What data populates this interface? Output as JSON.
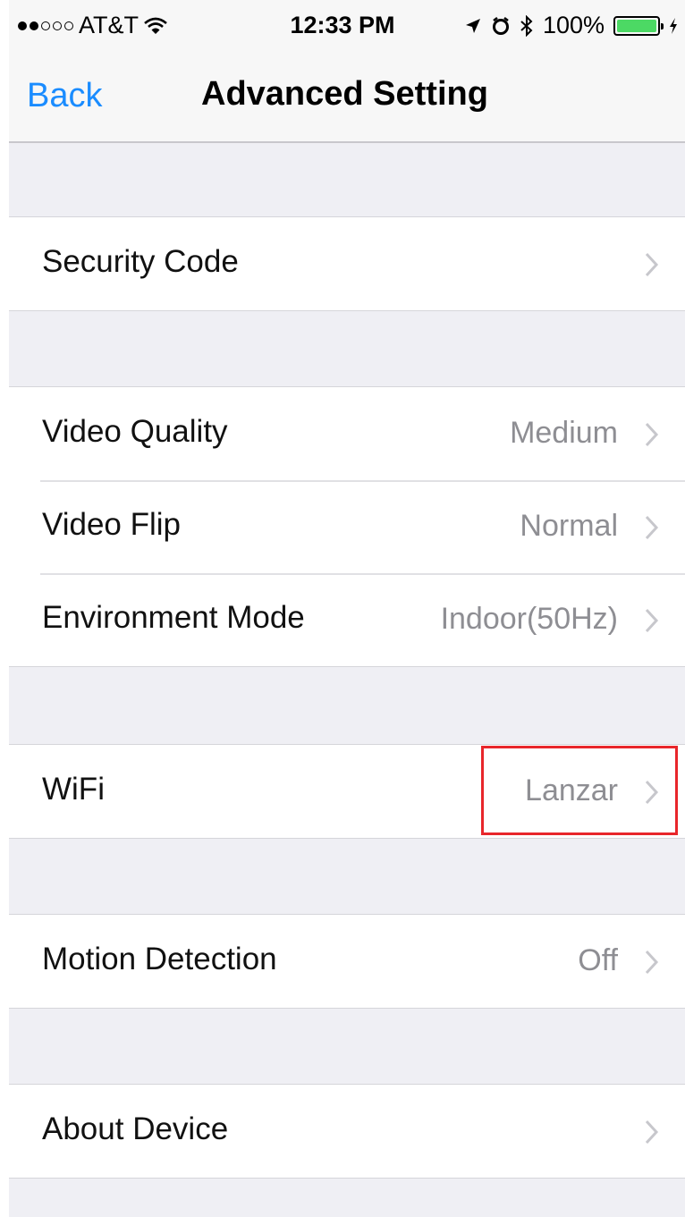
{
  "status_bar": {
    "carrier": "AT&T",
    "time": "12:33 PM",
    "battery": "100%",
    "battery_level": 1.0,
    "icons": [
      "signal-dots-icon",
      "wifi-icon",
      "location-icon",
      "alarm-icon",
      "bluetooth-icon",
      "battery-icon",
      "charging-icon"
    ]
  },
  "nav": {
    "back_label": "Back",
    "title": "Advanced Setting"
  },
  "groups": [
    {
      "rows": [
        {
          "label": "Security Code",
          "value": ""
        }
      ]
    },
    {
      "rows": [
        {
          "label": "Video Quality",
          "value": "Medium"
        },
        {
          "label": "Video Flip",
          "value": "Normal"
        },
        {
          "label": "Environment Mode",
          "value": "Indoor(50Hz)"
        }
      ]
    },
    {
      "rows": [
        {
          "label": "WiFi",
          "value": "Lanzar"
        }
      ]
    },
    {
      "rows": [
        {
          "label": "Motion Detection",
          "value": "Off"
        }
      ]
    },
    {
      "rows": [
        {
          "label": "About Device",
          "value": ""
        }
      ]
    }
  ],
  "colors": {
    "accent": "#1a8cff",
    "highlight": "#e8262b",
    "background": "#efeff4"
  }
}
